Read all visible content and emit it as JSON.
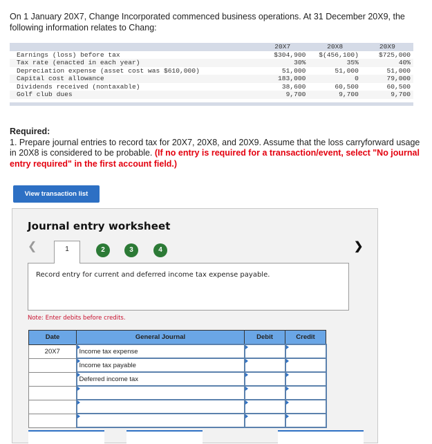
{
  "intro": "On 1 January 20X7, Change Incorporated commenced business operations. At 31 December 20X9, the following information relates to Chang:",
  "data_table": {
    "columns": [
      "20X7",
      "20X8",
      "20X9"
    ],
    "rows": [
      {
        "label": "Earnings (loss) before tax",
        "values": [
          "$304,900",
          "$(456,100)",
          "$725,000"
        ]
      },
      {
        "label": "Tax rate (enacted in each year)",
        "values": [
          "30%",
          "35%",
          "40%"
        ]
      },
      {
        "label": "Depreciation expense (asset cost was $610,000)",
        "values": [
          "51,000",
          "51,000",
          "51,000"
        ]
      },
      {
        "label": "Capital cost allowance",
        "values": [
          "183,000",
          "0",
          "79,000"
        ]
      },
      {
        "label": "Dividends received (nontaxable)",
        "values": [
          "38,600",
          "60,500",
          "60,500"
        ]
      },
      {
        "label": "Golf club dues",
        "values": [
          "9,700",
          "9,700",
          "9,700"
        ]
      }
    ]
  },
  "required": {
    "title": "Required:",
    "text": "1. Prepare journal entries to record tax for 20X7, 20X8, and 20X9. Assume that the loss carryforward usage in 20X8 is considered to be probable.",
    "instruction": "(If no entry is required for a transaction/event, select \"No journal entry required\" in the first account field.)"
  },
  "view_transaction_list_label": "View transaction list",
  "worksheet": {
    "title": "Journal entry worksheet",
    "current_step": "1",
    "steps": [
      "2",
      "3",
      "4"
    ],
    "prev_icon": "chevron-left-icon",
    "next_icon": "chevron-right-icon",
    "prompt": "Record entry for current and deferred income tax expense payable.",
    "note": "Note: Enter debits before credits.",
    "journal": {
      "headers": {
        "date": "Date",
        "account": "General Journal",
        "debit": "Debit",
        "credit": "Credit"
      },
      "rows": [
        {
          "date": "20X7",
          "account": "Income tax expense",
          "debit": "",
          "credit": ""
        },
        {
          "date": "",
          "account": "Income tax payable",
          "debit": "",
          "credit": ""
        },
        {
          "date": "",
          "account": "Deferred income tax",
          "debit": "",
          "credit": ""
        },
        {
          "date": "",
          "account": "",
          "debit": "",
          "credit": ""
        },
        {
          "date": "",
          "account": "",
          "debit": "",
          "credit": ""
        },
        {
          "date": "",
          "account": "",
          "debit": "",
          "credit": ""
        }
      ]
    }
  },
  "colors": {
    "primary_button": "#2d70c4",
    "step_green": "#2c7a36",
    "table_header_blue": "#6aa6e6",
    "warning_red": "#e3000f"
  }
}
